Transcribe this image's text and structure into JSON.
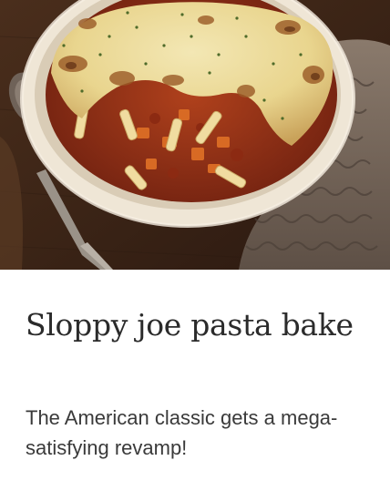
{
  "recipe": {
    "title": "Sloppy joe pasta bake",
    "description": "The American classic gets a mega-satisfying revamp!"
  }
}
